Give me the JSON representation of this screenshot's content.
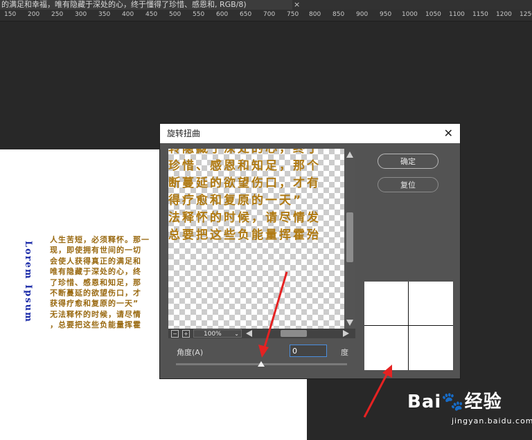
{
  "app": {
    "document_tab_title": "的满足和幸福，唯有隐藏于深处的心，终于懂得了珍惜、感恩和, RGB/8)",
    "tab_close_glyph": "×"
  },
  "ruler": {
    "ticks": [
      "150",
      "200",
      "250",
      "300",
      "350",
      "400",
      "450",
      "500",
      "550",
      "600",
      "650",
      "700",
      "750",
      "800",
      "850",
      "900",
      "950",
      "1000",
      "1050",
      "1100",
      "1150",
      "1200",
      "1250"
    ]
  },
  "canvas": {
    "vertical_title": "Lorem Ipsum",
    "poem_lines": [
      "人生苦短，必须释怀。那一",
      "现，即使拥有世间的一切",
      "会使人获得真正的满足和",
      "唯有隐藏于深处的心，终",
      "了珍惜、感恩和知足，那",
      "不断蔓延的欲望伤口，才",
      "获得疗愈和复原的一天”",
      "无法释怀的时候，请尽情",
      "，总要把这些负能量挥霍"
    ]
  },
  "dialog": {
    "title": "旋转扭曲",
    "close_glyph": "✕",
    "ok_label": "确定",
    "reset_label": "复位",
    "preview_lines": [
      "转隐藏于深处的心，终于",
      "珍惜、感恩和知足，那个",
      "断蔓延的欲望伤口，才有",
      "得疗愈和复原的一天”",
      "法释怀的时候，请尽情发",
      "总要把这些负能量挥霍殆"
    ],
    "zoom_value": "100%",
    "zoom_minus": "−",
    "zoom_plus": "+",
    "dropdown_glyph": "⌄",
    "angle_label": "角度(A)",
    "angle_value": "0",
    "angle_unit": "度"
  },
  "watermark": {
    "brand": "Bai🐾经验",
    "url": "jingyan.baidu.com"
  },
  "colors": {
    "dialog_bg": "#535353",
    "accent_input": "#4b8fe0",
    "annotation_arrow": "#e52222",
    "poem_text": "#9a6a12",
    "lorem_text": "#1a2aa8"
  },
  "icons": [
    "close-icon",
    "scroll-up-icon",
    "scroll-down-icon",
    "scroll-left-icon",
    "scroll-right-icon",
    "zoom-out-icon",
    "zoom-in-icon",
    "chevron-down-icon",
    "slider-thumb-icon"
  ]
}
